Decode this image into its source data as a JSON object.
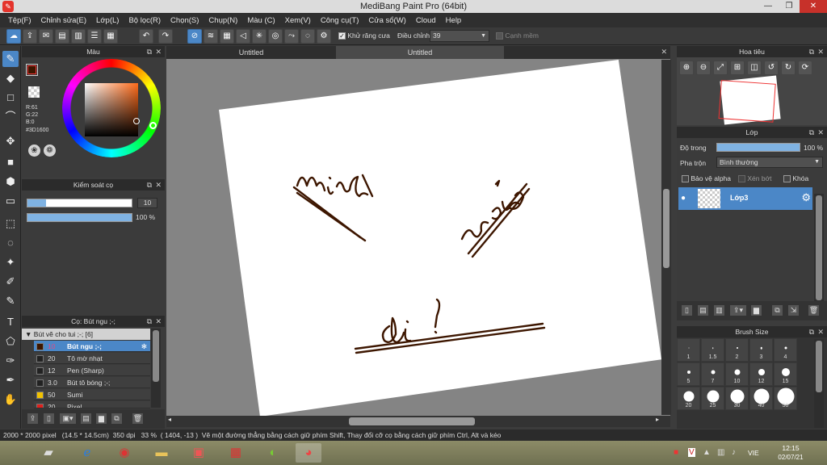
{
  "window": {
    "title": "MediBang Paint Pro (64bit)",
    "app_icon": "medibang-icon"
  },
  "menu": [
    "Tệp(F)",
    "Chỉnh sửa(E)",
    "Lớp(L)",
    "Bộ lọc(R)",
    "Chọn(S)",
    "Chụp(N)",
    "Màu (C)",
    "Xem(V)",
    "Công cụ(T)",
    "Cửa sổ(W)",
    "Cloud",
    "Help"
  ],
  "toolbar": {
    "antialias_label": "Khử răng cưa",
    "correction_label": "Điều chỉnh",
    "correction_value": "39",
    "soft_edge_label": "Cạnh mềm"
  },
  "tabs": [
    "Untitled",
    "Untitled"
  ],
  "color_panel": {
    "title": "Màu",
    "rgb": "R:61\nG:22\nB:0",
    "hex": "#3D1600",
    "primary_color": "#3d1600",
    "secondary_color": "#a8c8ec"
  },
  "brush_control": {
    "title": "Kiểm soát cọ",
    "size_value": "10",
    "opacity_value": "100 %",
    "size_fraction": 0.18,
    "opacity_fraction": 1.0
  },
  "brush_panel": {
    "title": "Cọ: Bút ngu ;-;",
    "group_label": "Bút vẽ cho tui ;-; [6]",
    "items": [
      {
        "size": "10",
        "name": "Bút ngu ;-;",
        "color": "#3d1600",
        "selected": true
      },
      {
        "size": "20",
        "name": "Tô mờ nhạt",
        "color": "#222222",
        "selected": false
      },
      {
        "size": "12",
        "name": "Pen (Sharp)",
        "color": "#222222",
        "selected": false
      },
      {
        "size": "3.0",
        "name": "Bút tô bóng ;-;",
        "color": "#222222",
        "selected": false
      },
      {
        "size": "50",
        "name": "Sumi",
        "color": "#f2c200",
        "selected": false
      },
      {
        "size": "20",
        "name": "Pixel",
        "color": "#e0201c",
        "selected": false
      }
    ]
  },
  "navigator": {
    "title": "Hoa tiêu"
  },
  "layer_panel": {
    "title": "Lớp",
    "opacity_label": "Độ trong",
    "opacity_value": "100 %",
    "blend_label": "Pha trộn",
    "blend_value": "Bình thường",
    "protect_alpha": "Bảo vệ alpha",
    "clipping": "Xén bớt",
    "lock": "Khóa",
    "layer_name": "Lớp3"
  },
  "brush_size_panel": {
    "title": "Brush Size",
    "sizes": [
      "1",
      "1.5",
      "2",
      "3",
      "4",
      "5",
      "7",
      "10",
      "12",
      "15",
      "20",
      "25",
      "30",
      "40",
      "50"
    ]
  },
  "status_bar": {
    "image_size": "2000 * 2000 pixel",
    "physical": "(14.5 * 14.5cm)",
    "dpi": "350 dpi",
    "zoom": "33 %",
    "coords": "( 1404, -13 )",
    "hint": "Vẽ một đường thẳng bằng cách giữ phím Shift, Thay đổi cỡ cọ bằng cách giữ phím Ctrl, Alt và kéo"
  },
  "taskbar": {
    "language": "VIE",
    "time": "12:15",
    "date": "02/07/21"
  }
}
